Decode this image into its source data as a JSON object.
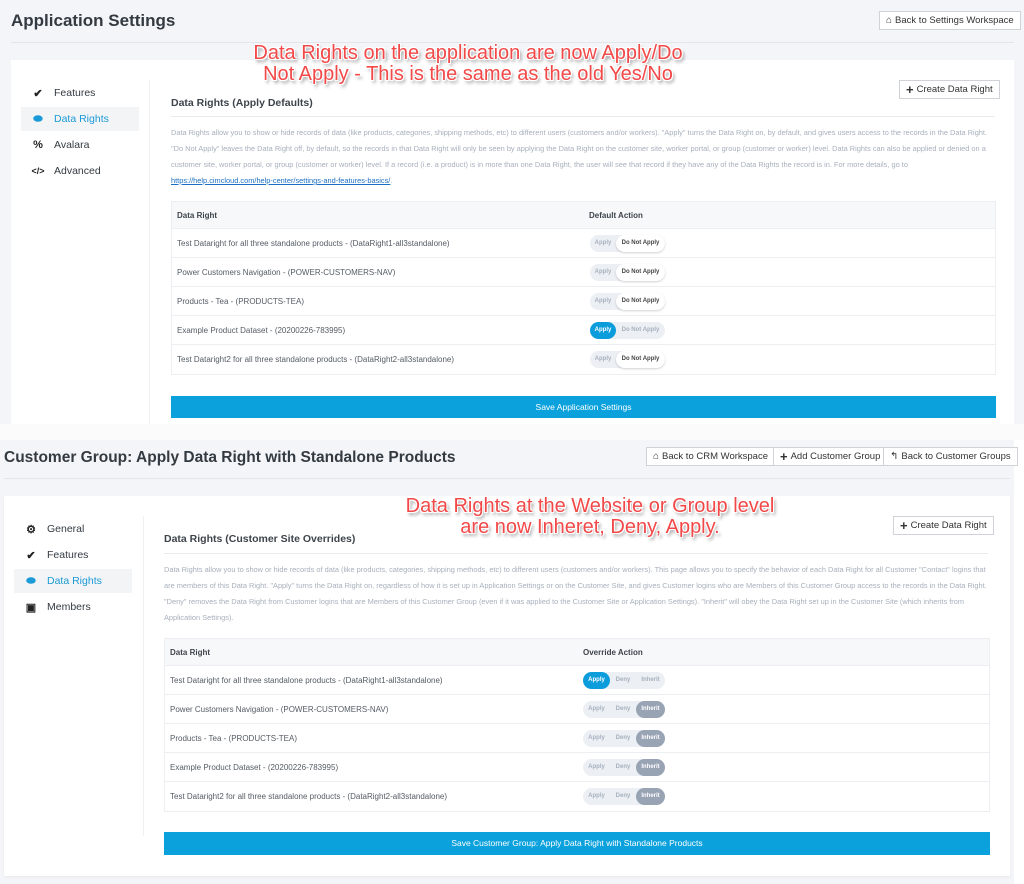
{
  "top": {
    "page_title": "Application Settings",
    "back_button": {
      "icon": "home-icon",
      "label": "Back to Settings Workspace"
    },
    "sidebar": [
      {
        "icon": "double-check-icon",
        "label": "Features",
        "active": false
      },
      {
        "icon": "database-icon",
        "label": "Data Rights",
        "active": true
      },
      {
        "icon": "percent-icon",
        "label": "Avalara",
        "active": false
      },
      {
        "icon": "code-icon",
        "label": "Advanced",
        "active": false
      }
    ],
    "section_title": "Data Rights (Apply Defaults)",
    "create_button": {
      "icon": "plus-icon",
      "label": "Create Data Right"
    },
    "description": "Data Rights allow you to show or hide records of data (like products, categories, shipping methods, etc) to different users (customers and/or workers). \"Apply\" turns the Data Right on, by default, and gives users access to the records in the Data Right. \"Do Not Apply\" leaves the Data Right off, by default, so the records in that Data Right will only be seen by applying the Data Right on the customer site, worker portal, or group (customer or worker) level. Data Rights can also be applied or denied on a customer site, worker portal, or group (customer or worker) level. If a record (i.e. a product) is in more than one Data Right, the user will see that record if they have any of the Data Rights the record is in. For more details, go to ",
    "description_link": "https://help.cimcloud.com/help-center/settings-and-features-basics/",
    "description_end": ".",
    "table": {
      "headers": [
        "Data Right",
        "Default Action"
      ],
      "options": [
        "Apply",
        "Do Not Apply"
      ],
      "rows": [
        {
          "name": "Test Dataright for all three standalone products - (DataRight1-all3standalone)",
          "selected": "Do Not Apply"
        },
        {
          "name": "Power Customers Navigation - (POWER-CUSTOMERS-NAV)",
          "selected": "Do Not Apply"
        },
        {
          "name": "Products - Tea - (PRODUCTS-TEA)",
          "selected": "Do Not Apply"
        },
        {
          "name": "Example Product Dataset - (20200226-783995)",
          "selected": "Apply"
        },
        {
          "name": "Test Dataright2 for all three standalone products - (DataRight2-all3standalone)",
          "selected": "Do Not Apply"
        }
      ]
    },
    "save_label": "Save Application Settings",
    "annotation": [
      "Data Rights on the application are now Apply/Do",
      "Not Apply - This is the same as the old Yes/No"
    ]
  },
  "bottom": {
    "page_title": "Customer Group: Apply Data Right with Standalone Products",
    "header_buttons": [
      {
        "icon": "home-icon",
        "label": "Back to CRM Workspace"
      },
      {
        "icon": "plus-icon",
        "label": "Add Customer Group"
      },
      {
        "icon": "reply-icon",
        "label": "Back to Customer Groups"
      }
    ],
    "sidebar": [
      {
        "icon": "cogs-icon",
        "label": "General",
        "active": false
      },
      {
        "icon": "double-check-icon",
        "label": "Features",
        "active": false
      },
      {
        "icon": "database-icon",
        "label": "Data Rights",
        "active": true
      },
      {
        "icon": "contact-card-icon",
        "label": "Members",
        "active": false
      }
    ],
    "section_title": "Data Rights (Customer Site Overrides)",
    "create_button": {
      "icon": "plus-icon",
      "label": "Create Data Right"
    },
    "description": "Data Rights allow you to show or hide records of data (like products, categories, shipping methods, etc) to different users (customers and/or workers). This page allows you to specify the behavior of each Data Right for all Customer \"Contact\" logins that are members of this Data Right. \"Apply\" turns the Data Right on, regardless of how it is set up in Application Settings or on the Customer Site, and gives Customer logins who are Members of this Customer Group access to the records in the Data Right. \"Deny\" removes the Data Right from Customer logins that are Members of this Customer Group (even if it was applied to the Customer Site or Application Settings). \"Inherit\" will obey the Data Right set up in the Customer Site (which inherits from Application Settings).",
    "table": {
      "headers": [
        "Data Right",
        "Override Action"
      ],
      "options": [
        "Apply",
        "Deny",
        "Inherit"
      ],
      "rows": [
        {
          "name": "Test Dataright for all three standalone products - (DataRight1-all3standalone)",
          "selected": "Apply"
        },
        {
          "name": "Power Customers Navigation - (POWER-CUSTOMERS-NAV)",
          "selected": "Inherit"
        },
        {
          "name": "Products - Tea - (PRODUCTS-TEA)",
          "selected": "Inherit"
        },
        {
          "name": "Example Product Dataset - (20200226-783995)",
          "selected": "Inherit"
        },
        {
          "name": "Test Dataright2 for all three standalone products - (DataRight2-all3standalone)",
          "selected": "Inherit"
        }
      ]
    },
    "save_label": "Save Customer Group: Apply Data Right with Standalone Products",
    "annotation": [
      "Data Rights at the Website or Group level",
      "are now Inheret, Deny, Apply."
    ]
  },
  "icons": {
    "home-icon": "⌂",
    "plus-icon": "+",
    "reply-icon": "↰",
    "double-check-icon": "✔",
    "database-icon": "⬬",
    "percent-icon": "%",
    "code-icon": "</>",
    "cogs-icon": "⚙",
    "contact-card-icon": "▣"
  }
}
